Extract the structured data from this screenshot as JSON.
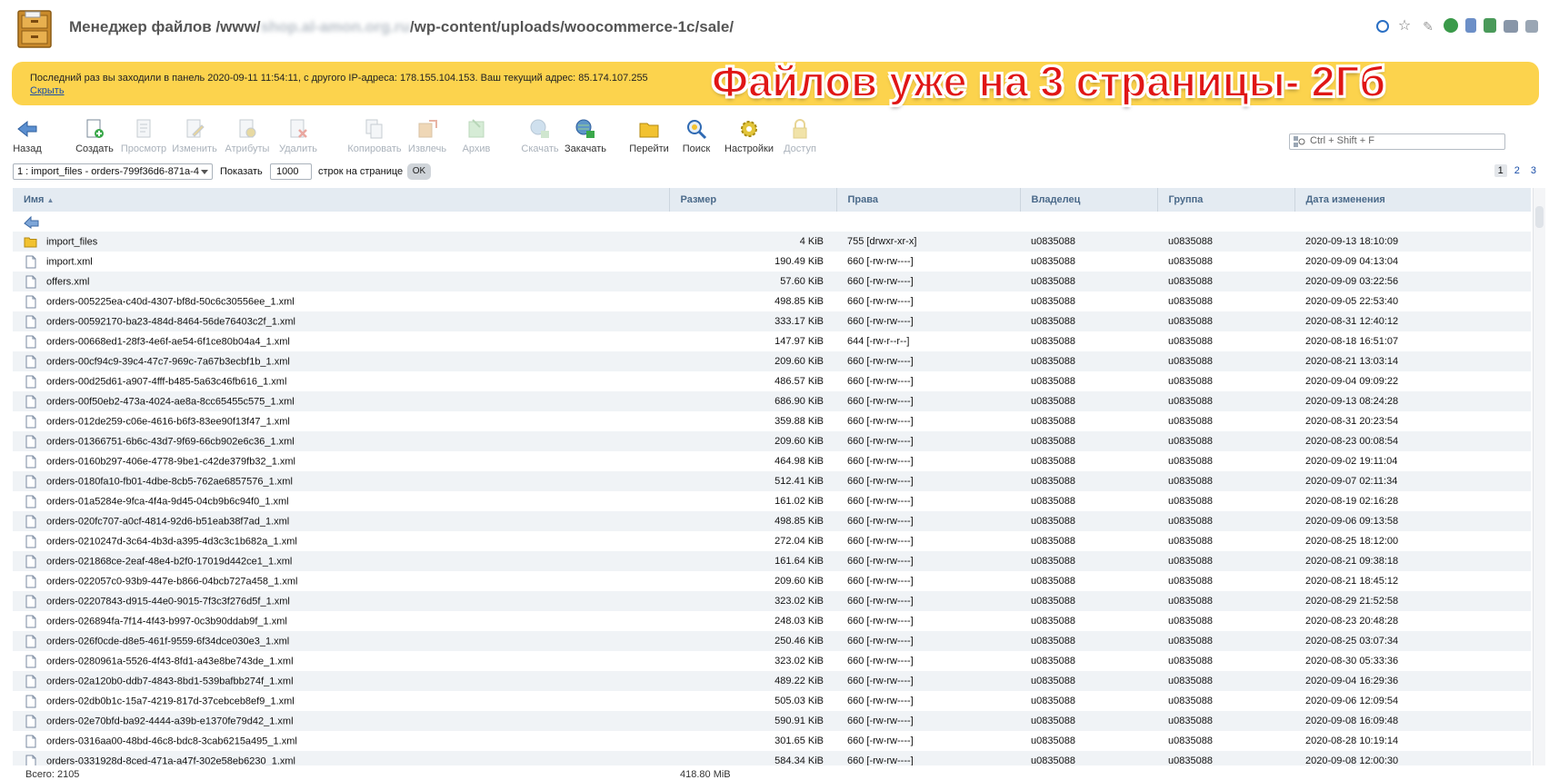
{
  "header": {
    "title_prefix": "Менеджер файлов /www/",
    "title_masked": "shop.al-amon.org.ru",
    "title_suffix": "/wp-content/uploads/woocommerce-1c/sale/"
  },
  "banner": {
    "info": "Последний раз вы заходили в панель 2020-09-11 11:54:11, с другого IP-адреса: 178.155.104.153. Ваш текущий адрес: 85.174.107.255",
    "hide_link": "Скрыть",
    "overlay": "Файлов уже на 3 страницы- 2Гб"
  },
  "toolbar": {
    "back": "Назад",
    "create": "Создать",
    "view": "Просмотр",
    "edit": "Изменить",
    "attributes": "Атрибуты",
    "delete": "Удалить",
    "copy": "Копировать",
    "extract": "Извлечь",
    "archive": "Архив",
    "download": "Скачать",
    "upload": "Закачать",
    "goto": "Перейти",
    "search": "Поиск",
    "settings": "Настройки",
    "access": "Доступ",
    "search_placeholder": "Ctrl + Shift + F"
  },
  "controls": {
    "selected": "1 : import_files - orders-799f36d6-871a-4",
    "show_label": "Показать",
    "rows_value": "1000",
    "rows_label": "строк на странице",
    "ok": "OK",
    "pages": [
      "1",
      "2",
      "3"
    ]
  },
  "columns": {
    "name": "Имя",
    "size": "Размер",
    "rights": "Права",
    "owner": "Владелец",
    "group": "Группа",
    "modified": "Дата изменения"
  },
  "files": [
    {
      "name": "import_files",
      "type": "folder",
      "size": "4 KiB",
      "rights": "755 [drwxr-xr-x]",
      "owner": "u0835088",
      "group": "u0835088",
      "modified": "2020-09-13 18:10:09"
    },
    {
      "name": "import.xml",
      "type": "file",
      "size": "190.49 KiB",
      "rights": "660 [-rw-rw----]",
      "owner": "u0835088",
      "group": "u0835088",
      "modified": "2020-09-09 04:13:04"
    },
    {
      "name": "offers.xml",
      "type": "file",
      "size": "57.60 KiB",
      "rights": "660 [-rw-rw----]",
      "owner": "u0835088",
      "group": "u0835088",
      "modified": "2020-09-09 03:22:56"
    },
    {
      "name": "orders-005225ea-c40d-4307-bf8d-50c6c30556ee_1.xml",
      "type": "file",
      "size": "498.85 KiB",
      "rights": "660 [-rw-rw----]",
      "owner": "u0835088",
      "group": "u0835088",
      "modified": "2020-09-05 22:53:40"
    },
    {
      "name": "orders-00592170-ba23-484d-8464-56de76403c2f_1.xml",
      "type": "file",
      "size": "333.17 KiB",
      "rights": "660 [-rw-rw----]",
      "owner": "u0835088",
      "group": "u0835088",
      "modified": "2020-08-31 12:40:12"
    },
    {
      "name": "orders-00668ed1-28f3-4e6f-ae54-6f1ce80b04a4_1.xml",
      "type": "file",
      "size": "147.97 KiB",
      "rights": "644 [-rw-r--r--]",
      "owner": "u0835088",
      "group": "u0835088",
      "modified": "2020-08-18 16:51:07"
    },
    {
      "name": "orders-00cf94c9-39c4-47c7-969c-7a67b3ecbf1b_1.xml",
      "type": "file",
      "size": "209.60 KiB",
      "rights": "660 [-rw-rw----]",
      "owner": "u0835088",
      "group": "u0835088",
      "modified": "2020-08-21 13:03:14"
    },
    {
      "name": "orders-00d25d61-a907-4fff-b485-5a63c46fb616_1.xml",
      "type": "file",
      "size": "486.57 KiB",
      "rights": "660 [-rw-rw----]",
      "owner": "u0835088",
      "group": "u0835088",
      "modified": "2020-09-04 09:09:22"
    },
    {
      "name": "orders-00f50eb2-473a-4024-ae8a-8cc65455c575_1.xml",
      "type": "file",
      "size": "686.90 KiB",
      "rights": "660 [-rw-rw----]",
      "owner": "u0835088",
      "group": "u0835088",
      "modified": "2020-09-13 08:24:28"
    },
    {
      "name": "orders-012de259-c06e-4616-b6f3-83ee90f13f47_1.xml",
      "type": "file",
      "size": "359.88 KiB",
      "rights": "660 [-rw-rw----]",
      "owner": "u0835088",
      "group": "u0835088",
      "modified": "2020-08-31 20:23:54"
    },
    {
      "name": "orders-01366751-6b6c-43d7-9f69-66cb902e6c36_1.xml",
      "type": "file",
      "size": "209.60 KiB",
      "rights": "660 [-rw-rw----]",
      "owner": "u0835088",
      "group": "u0835088",
      "modified": "2020-08-23 00:08:54"
    },
    {
      "name": "orders-0160b297-406e-4778-9be1-c42de379fb32_1.xml",
      "type": "file",
      "size": "464.98 KiB",
      "rights": "660 [-rw-rw----]",
      "owner": "u0835088",
      "group": "u0835088",
      "modified": "2020-09-02 19:11:04"
    },
    {
      "name": "orders-0180fa10-fb01-4dbe-8cb5-762ae6857576_1.xml",
      "type": "file",
      "size": "512.41 KiB",
      "rights": "660 [-rw-rw----]",
      "owner": "u0835088",
      "group": "u0835088",
      "modified": "2020-09-07 02:11:34"
    },
    {
      "name": "orders-01a5284e-9fca-4f4a-9d45-04cb9b6c94f0_1.xml",
      "type": "file",
      "size": "161.02 KiB",
      "rights": "660 [-rw-rw----]",
      "owner": "u0835088",
      "group": "u0835088",
      "modified": "2020-08-19 02:16:28"
    },
    {
      "name": "orders-020fc707-a0cf-4814-92d6-b51eab38f7ad_1.xml",
      "type": "file",
      "size": "498.85 KiB",
      "rights": "660 [-rw-rw----]",
      "owner": "u0835088",
      "group": "u0835088",
      "modified": "2020-09-06 09:13:58"
    },
    {
      "name": "orders-0210247d-3c64-4b3d-a395-4d3c3c1b682a_1.xml",
      "type": "file",
      "size": "272.04 KiB",
      "rights": "660 [-rw-rw----]",
      "owner": "u0835088",
      "group": "u0835088",
      "modified": "2020-08-25 18:12:00"
    },
    {
      "name": "orders-021868ce-2eaf-48e4-b2f0-17019d442ce1_1.xml",
      "type": "file",
      "size": "161.64 KiB",
      "rights": "660 [-rw-rw----]",
      "owner": "u0835088",
      "group": "u0835088",
      "modified": "2020-08-21 09:38:18"
    },
    {
      "name": "orders-022057c0-93b9-447e-b866-04bcb727a458_1.xml",
      "type": "file",
      "size": "209.60 KiB",
      "rights": "660 [-rw-rw----]",
      "owner": "u0835088",
      "group": "u0835088",
      "modified": "2020-08-21 18:45:12"
    },
    {
      "name": "orders-02207843-d915-44e0-9015-7f3c3f276d5f_1.xml",
      "type": "file",
      "size": "323.02 KiB",
      "rights": "660 [-rw-rw----]",
      "owner": "u0835088",
      "group": "u0835088",
      "modified": "2020-08-29 21:52:58"
    },
    {
      "name": "orders-026894fa-7f14-4f43-b997-0c3b90ddab9f_1.xml",
      "type": "file",
      "size": "248.03 KiB",
      "rights": "660 [-rw-rw----]",
      "owner": "u0835088",
      "group": "u0835088",
      "modified": "2020-08-23 20:48:28"
    },
    {
      "name": "orders-026f0cde-d8e5-461f-9559-6f34dce030e3_1.xml",
      "type": "file",
      "size": "250.46 KiB",
      "rights": "660 [-rw-rw----]",
      "owner": "u0835088",
      "group": "u0835088",
      "modified": "2020-08-25 03:07:34"
    },
    {
      "name": "orders-0280961a-5526-4f43-8fd1-a43e8be743de_1.xml",
      "type": "file",
      "size": "323.02 KiB",
      "rights": "660 [-rw-rw----]",
      "owner": "u0835088",
      "group": "u0835088",
      "modified": "2020-08-30 05:33:36"
    },
    {
      "name": "orders-02a120b0-ddb7-4843-8bd1-539bafbb274f_1.xml",
      "type": "file",
      "size": "489.22 KiB",
      "rights": "660 [-rw-rw----]",
      "owner": "u0835088",
      "group": "u0835088",
      "modified": "2020-09-04 16:29:36"
    },
    {
      "name": "orders-02db0b1c-15a7-4219-817d-37cebceb8ef9_1.xml",
      "type": "file",
      "size": "505.03 KiB",
      "rights": "660 [-rw-rw----]",
      "owner": "u0835088",
      "group": "u0835088",
      "modified": "2020-09-06 12:09:54"
    },
    {
      "name": "orders-02e70bfd-ba92-4444-a39b-e1370fe79d42_1.xml",
      "type": "file",
      "size": "590.91 KiB",
      "rights": "660 [-rw-rw----]",
      "owner": "u0835088",
      "group": "u0835088",
      "modified": "2020-09-08 16:09:48"
    },
    {
      "name": "orders-0316aa00-48bd-46c8-bdc8-3cab6215a495_1.xml",
      "type": "file",
      "size": "301.65 KiB",
      "rights": "660 [-rw-rw----]",
      "owner": "u0835088",
      "group": "u0835088",
      "modified": "2020-08-28 10:19:14"
    },
    {
      "name": "orders-0331928d-8ced-471a-a47f-302e58eb6230_1.xml",
      "type": "file",
      "size": "584.34 KiB",
      "rights": "660 [-rw-rw----]",
      "owner": "u0835088",
      "group": "u0835088",
      "modified": "2020-09-08 12:00:30"
    }
  ],
  "footer": {
    "total": "Всего: 2105",
    "total_size": "418.80 MiB"
  },
  "colors": {
    "banner": "#fcd34d",
    "overlay_text": "#e01616",
    "header_row": "#e4ebf2",
    "alt_row": "#f0f3f6"
  }
}
